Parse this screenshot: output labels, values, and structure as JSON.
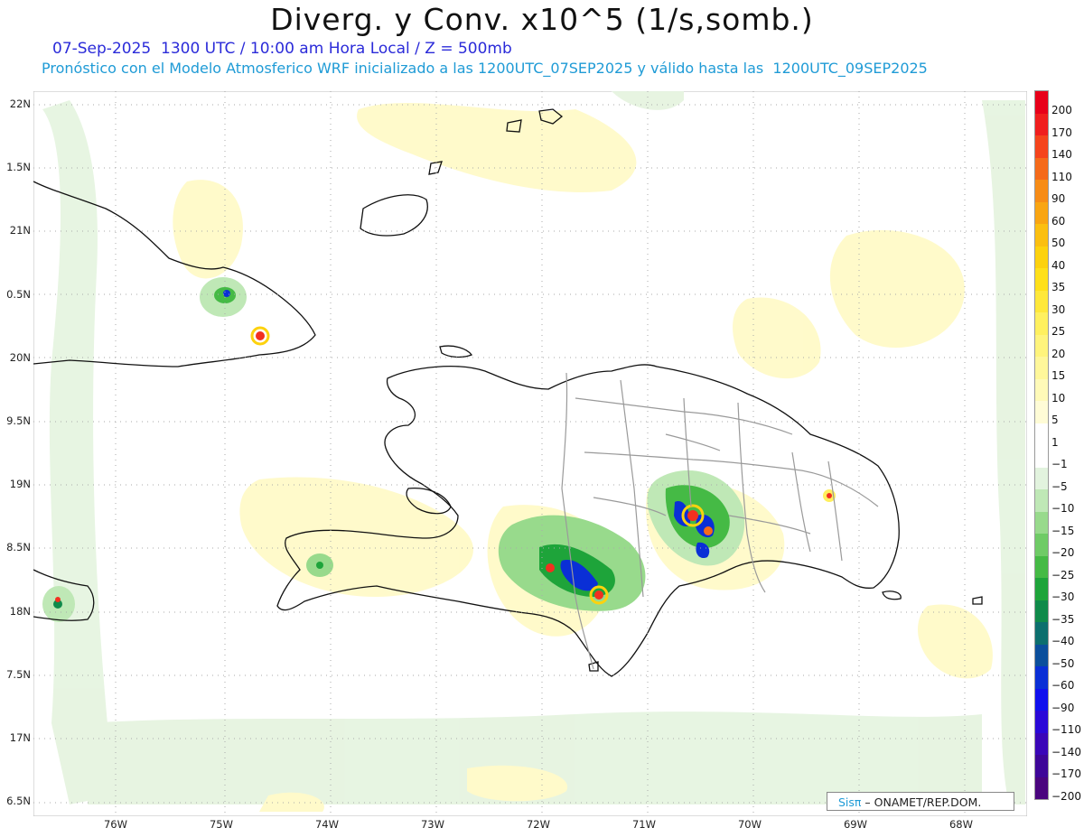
{
  "title": "Diverg. y Conv. x10^5 (1/s,somb.)",
  "subtitle_1": "07-Sep-2025  1300 UTC / 10:00 am Hora Local / Z = 500mb",
  "subtitle_2": "Pronóstico con el Modelo Atmosferico WRF inicializado a las 1200UTC_07SEP2025 y válido hasta las  1200UTC_09SEP2025",
  "lat_labels": [
    "22N",
    "1.5N",
    "21N",
    "0.5N",
    "20N",
    "9.5N",
    "19N",
    "8.5N",
    "18N",
    "7.5N",
    "17N",
    "6.5N"
  ],
  "lon_labels": [
    "76W",
    "75W",
    "74W",
    "73W",
    "72W",
    "71W",
    "70W",
    "69W",
    "68W"
  ],
  "colorbar": {
    "labels": [
      "200",
      "170",
      "140",
      "110",
      "90",
      "60",
      "50",
      "40",
      "35",
      "30",
      "25",
      "20",
      "15",
      "10",
      "5",
      "1",
      "−1",
      "−5",
      "−10",
      "−15",
      "−20",
      "−25",
      "−30",
      "−35",
      "−40",
      "−50",
      "−60",
      "−90",
      "−110",
      "−140",
      "−170",
      "−200"
    ],
    "colors": [
      "#e8001a",
      "#f01e1e",
      "#f5441c",
      "#f56a1a",
      "#f78c16",
      "#f9a512",
      "#fbbf10",
      "#fdd20e",
      "#ffe01a",
      "#ffe83a",
      "#fff05e",
      "#fff47c",
      "#fff79a",
      "#fffab8",
      "#fffcd6",
      "#ffffff",
      "#ffffff",
      "#e2f3de",
      "#bfe8b6",
      "#98da8c",
      "#6fcb66",
      "#45ba45",
      "#1ea43a",
      "#0f8a4a",
      "#0c6f6e",
      "#0b4f9c",
      "#0a2fd6",
      "#1010ee",
      "#2a08d8",
      "#3a06b8",
      "#3e0698",
      "#4a057e"
    ]
  },
  "credit": {
    "brand": "Sisπ",
    "text": " – ONAMET/REP.DOM."
  },
  "field_colors": {
    "weak_div": "#fffac8",
    "weak_conv": "#e6f4e0",
    "conv_mid": "#7fd077",
    "conv_strong": "#0a2fd6",
    "div_strong": "#f23020"
  }
}
